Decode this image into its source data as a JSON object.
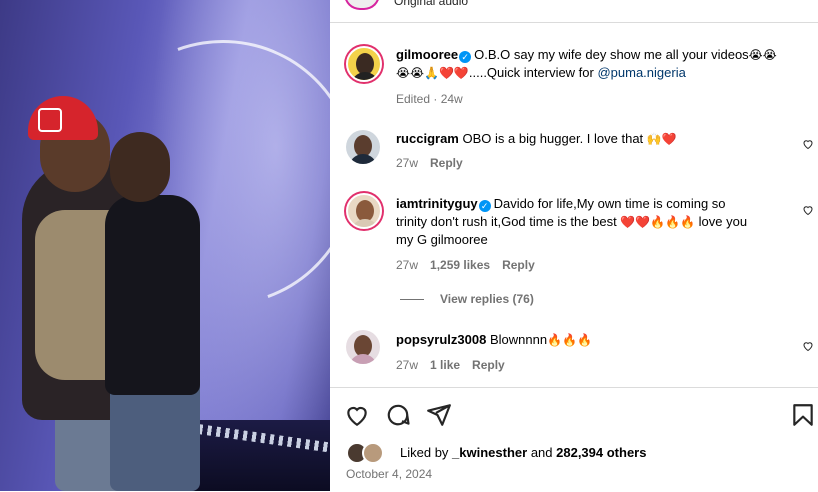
{
  "top": {
    "audio_label": "Original audio"
  },
  "caption": {
    "username": "gilmooree",
    "text_line1": "O.B.O say my wife dey show me all your videos",
    "emoji_line1": "😭😭",
    "emoji_line2": "😭😭🙏❤️❤️",
    "text_line2": ".....Quick interview for ",
    "mention": "@puma.nigeria",
    "meta_edited": "Edited · 24w"
  },
  "comments": [
    {
      "username": "ruccigram",
      "text": "OBO is a big hugger. I love that ",
      "emoji": "🙌❤️",
      "time": "27w",
      "reply_label": "Reply"
    },
    {
      "username": "iamtrinityguy",
      "line1": "Davido for life,My own time is coming so",
      "line2_pre": "trinity don't rush it,God time is the best ",
      "line2_emoji": "❤️❤️🔥🔥🔥",
      "line2_post": " love you",
      "line3": "my G gilmooree",
      "time": "27w",
      "likes": "1,259 likes",
      "reply_label": "Reply"
    },
    {
      "username": "popsyrulz3008",
      "text": "Blownnnn",
      "emoji": "🔥🔥🔥",
      "time": "27w",
      "likes": "1 like",
      "reply_label": "Reply"
    }
  ],
  "view_replies": "View replies (76)",
  "footer": {
    "liked_by_prefix": "Liked by ",
    "liked_by_user": "_kwinesther",
    "liked_by_and": " and ",
    "liked_by_count": "282,394 others",
    "date": "October 4, 2024"
  },
  "icons": [
    "heart-icon",
    "comment-icon",
    "share-icon",
    "bookmark-icon",
    "verified-icon"
  ],
  "colors": {
    "verified": "#0095f6",
    "ring": "#e1306c",
    "meta": "#737373",
    "mention": "#00376b"
  }
}
